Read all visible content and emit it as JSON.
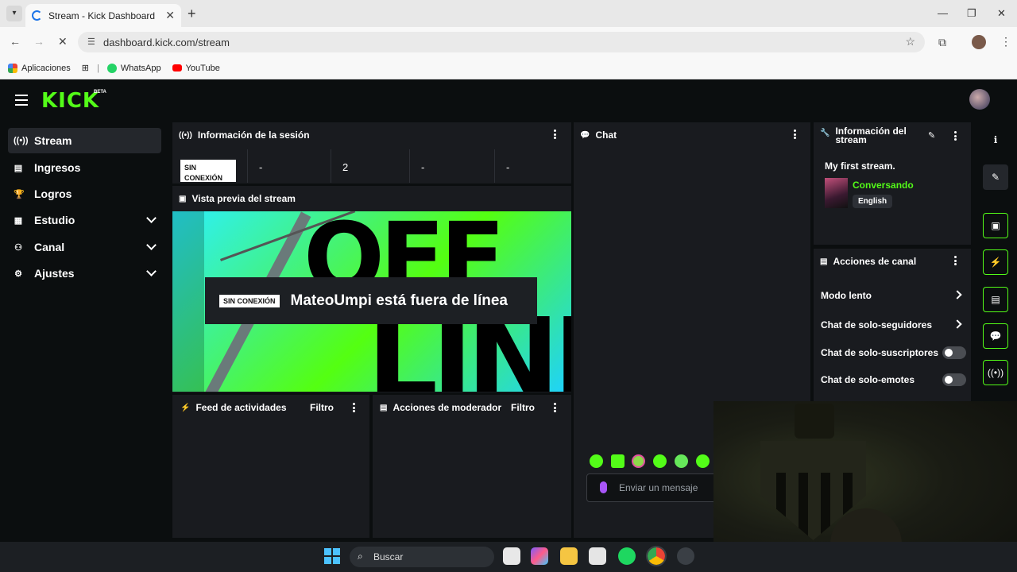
{
  "browser": {
    "tab_title": "Stream - Kick Dashboard",
    "url": "dashboard.kick.com/stream",
    "bookmarks": [
      {
        "label": "Aplicaciones",
        "icon": "apps-grid-icon"
      },
      {
        "label": "WhatsApp",
        "icon": "whatsapp-icon"
      },
      {
        "label": "YouTube",
        "icon": "youtube-icon"
      }
    ]
  },
  "header": {
    "logo": "KICK",
    "logo_badge": "BETA"
  },
  "sidebar": {
    "items": [
      {
        "label": "Stream",
        "icon": "stream-icon"
      },
      {
        "label": "Ingresos",
        "icon": "revenue-icon"
      },
      {
        "label": "Logros",
        "icon": "trophy-icon"
      },
      {
        "label": "Estudio",
        "icon": "studio-icon"
      },
      {
        "label": "Canal",
        "icon": "channel-icon"
      },
      {
        "label": "Ajustes",
        "icon": "settings-icon"
      }
    ]
  },
  "session": {
    "title": "Información de la sesión",
    "status": "SIN CONEXIÓN",
    "stats": [
      "-",
      "2",
      "-",
      "-"
    ]
  },
  "preview": {
    "title": "Vista previa del stream",
    "badge": "SIN CONEXIÓN",
    "message": "MateoUmpi está fuera de línea"
  },
  "activity": {
    "title": "Feed de actividades",
    "filter": "Filtro"
  },
  "moderator": {
    "title": "Acciones de moderador",
    "filter": "Filtro"
  },
  "chat": {
    "title": "Chat",
    "placeholder": "Enviar un mensaje"
  },
  "stream_info": {
    "title": "Información del stream",
    "stream_title": "My first stream.",
    "category": "Conversando",
    "language": "English"
  },
  "channel_actions": {
    "title": "Acciones de canal",
    "rows": [
      {
        "label": "Modo lento",
        "control": "arrow"
      },
      {
        "label": "Chat de solo-seguidores",
        "control": "arrow"
      },
      {
        "label": "Chat de solo-suscriptores",
        "control": "toggle",
        "on": false
      },
      {
        "label": "Chat de solo-emotes",
        "control": "toggle",
        "on": false
      }
    ]
  },
  "taskbar": {
    "search": "Buscar"
  },
  "colors": {
    "accent": "#53fc18",
    "panel": "#191b1f",
    "background": "#0b0e0f"
  }
}
